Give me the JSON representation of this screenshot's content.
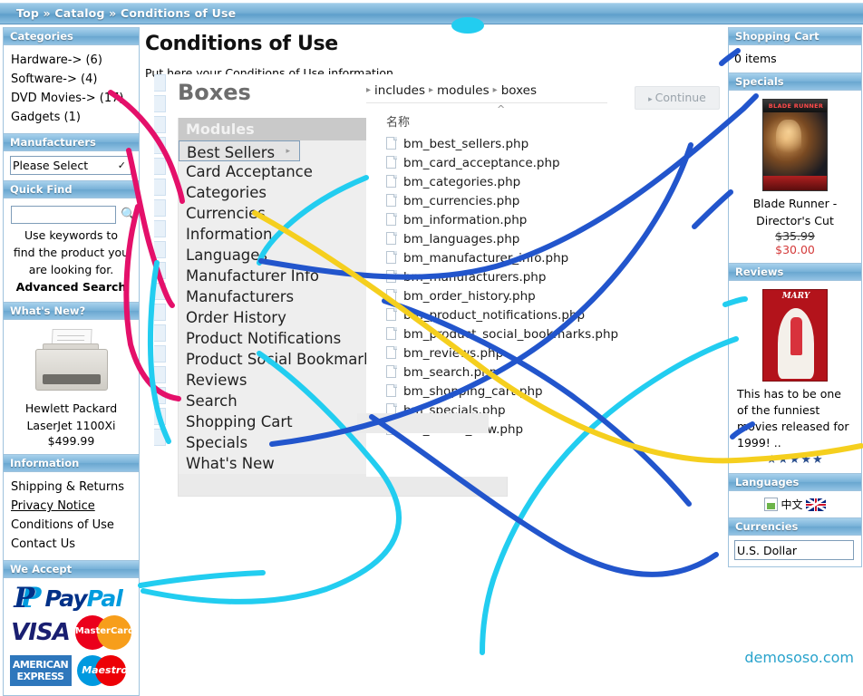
{
  "breadcrumb": "Top » Catalog » Conditions of Use",
  "sidebar_left": {
    "categories": {
      "title": "Categories",
      "items": [
        "Hardware-> (6)",
        "Software-> (4)",
        "DVD Movies-> (17)",
        "Gadgets (1)"
      ]
    },
    "manufacturers": {
      "title": "Manufacturers",
      "selected": "Please Select",
      "options": [
        "Please Select"
      ]
    },
    "quick_find": {
      "title": "Quick Find",
      "input_value": "",
      "placeholder": "",
      "search_icon": "magnifier-icon",
      "help_text": "Use keywords to find the product you are looking for.",
      "advanced_link": "Advanced Search"
    },
    "whats_new": {
      "title": "What's New?",
      "product_name_line1": "Hewlett Packard",
      "product_name_line2": "LaserJet 1100Xi",
      "price": "$499.99"
    },
    "information": {
      "title": "Information",
      "items": [
        "Shipping & Returns",
        "Privacy Notice",
        "Conditions of Use",
        "Contact Us"
      ],
      "underlined_index": 1
    },
    "we_accept": {
      "title": "We Accept",
      "logos": [
        "paypal-logo",
        "visa-logo",
        "mastercard-logo",
        "amex-logo",
        "maestro-logo"
      ],
      "paypal_text": "PayPal",
      "visa_text": "VISA",
      "mastercard_text": "MasterCard",
      "amex_line1": "AMERICAN",
      "amex_line2": "EXPRESS",
      "maestro_text": "Maestro"
    }
  },
  "main": {
    "page_title": "Conditions of Use",
    "subtitle": "Put here your Conditions of Use information",
    "continue_button": "Continue"
  },
  "boxes_panel": {
    "heading": "Boxes",
    "column_header": "Modules",
    "rows": [
      {
        "label": "Best Sellers",
        "selected": true,
        "arrow": true
      },
      {
        "label": "Card Acceptance",
        "selected": false,
        "arrow": true
      },
      {
        "label": "Categories",
        "selected": false,
        "arrow": true
      },
      {
        "label": "Currencies",
        "selected": false,
        "arrow": true
      },
      {
        "label": "Information",
        "selected": false,
        "arrow": false
      },
      {
        "label": "Languages",
        "selected": false,
        "arrow": false
      },
      {
        "label": "Manufacturer Info",
        "selected": false,
        "arrow": false
      },
      {
        "label": "Manufacturers",
        "selected": false,
        "arrow": false
      },
      {
        "label": "Order History",
        "selected": false,
        "arrow": false
      },
      {
        "label": "Product Notifications",
        "selected": false,
        "arrow": false
      },
      {
        "label": "Product Social Bookmarks",
        "selected": false,
        "arrow": false
      },
      {
        "label": "Reviews",
        "selected": false,
        "arrow": false
      },
      {
        "label": "Search",
        "selected": false,
        "arrow": false
      },
      {
        "label": "Shopping Cart",
        "selected": false,
        "arrow": false
      },
      {
        "label": "Specials",
        "selected": false,
        "arrow": false
      },
      {
        "label": "What's New",
        "selected": false,
        "arrow": false
      }
    ]
  },
  "explorer": {
    "breadcrumb": [
      "includes",
      "modules",
      "boxes"
    ],
    "separator": "›",
    "column_header": "名称",
    "sort_indicator": "^",
    "files": [
      "bm_best_sellers.php",
      "bm_card_acceptance.php",
      "bm_categories.php",
      "bm_currencies.php",
      "bm_information.php",
      "bm_languages.php",
      "bm_manufacturer_info.php",
      "bm_manufacturers.php",
      "bm_order_history.php",
      "bm_product_notifications.php",
      "bm_product_social_bookmarks.php",
      "bm_reviews.php",
      "bm_search.php",
      "bm_shopping_cart.php",
      "bm_specials.php",
      "bm_whats_new.php"
    ]
  },
  "sidebar_right": {
    "shopping_cart": {
      "title": "Shopping Cart",
      "items_text": "0 items"
    },
    "specials": {
      "title": "Specials",
      "product_line1": "Blade Runner -",
      "product_line2": "Director's Cut",
      "old_price": "$35.99",
      "new_price": "$30.00",
      "cover_title": "BLADE RUNNER"
    },
    "reviews": {
      "title": "Reviews",
      "text": "This has to be one of the funniest movies released for 1999! ..",
      "stars": "★★★★★",
      "cover_title": "MARY"
    },
    "languages": {
      "title": "Languages",
      "items": [
        "中文",
        "english-flag"
      ]
    },
    "currencies": {
      "title": "Currencies",
      "selected": "U.S. Dollar",
      "options": [
        "U.S. Dollar"
      ]
    }
  },
  "watermark": "demososo.com",
  "annotations": {
    "colors": {
      "pink": "#e4106a",
      "cyan": "#22cdf0",
      "blue": "#2255cc",
      "yellow": "#f5cf1e"
    }
  }
}
